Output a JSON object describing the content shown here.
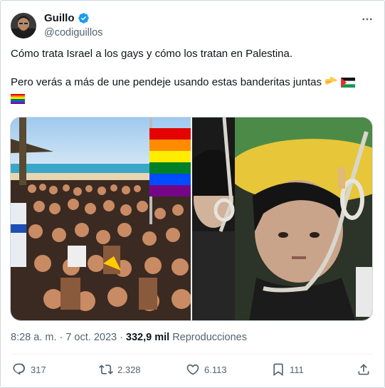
{
  "tweet": {
    "author": {
      "name": "Guillo",
      "handle": "@codiguillos",
      "verified": true
    },
    "text_line1": "Cómo trata Israel a los gays y cómo los tratan en Palestina.",
    "text_line2": "Pero verás a más de une pendeje usando estas banderitas juntas",
    "emojis": [
      "pointing-right-emoji",
      "palestine-flag-emoji",
      "rainbow-flag-emoji"
    ],
    "media": [
      {
        "name": "pride-parade-photo"
      },
      {
        "name": "execution-photo"
      }
    ],
    "meta": {
      "time": "8:28 a. m.",
      "separator": "·",
      "date": "7 oct. 2023",
      "separator2": "·",
      "views": "332,9 mil",
      "views_label": "Reproducciones"
    },
    "actions": {
      "replies": "317",
      "retweets": "2.328",
      "likes": "6.113",
      "bookmarks": "111"
    }
  },
  "colors": {
    "text": "#0f1419",
    "secondary": "#536471",
    "verified": "#1d9bf0",
    "border": "#cfd9de"
  }
}
